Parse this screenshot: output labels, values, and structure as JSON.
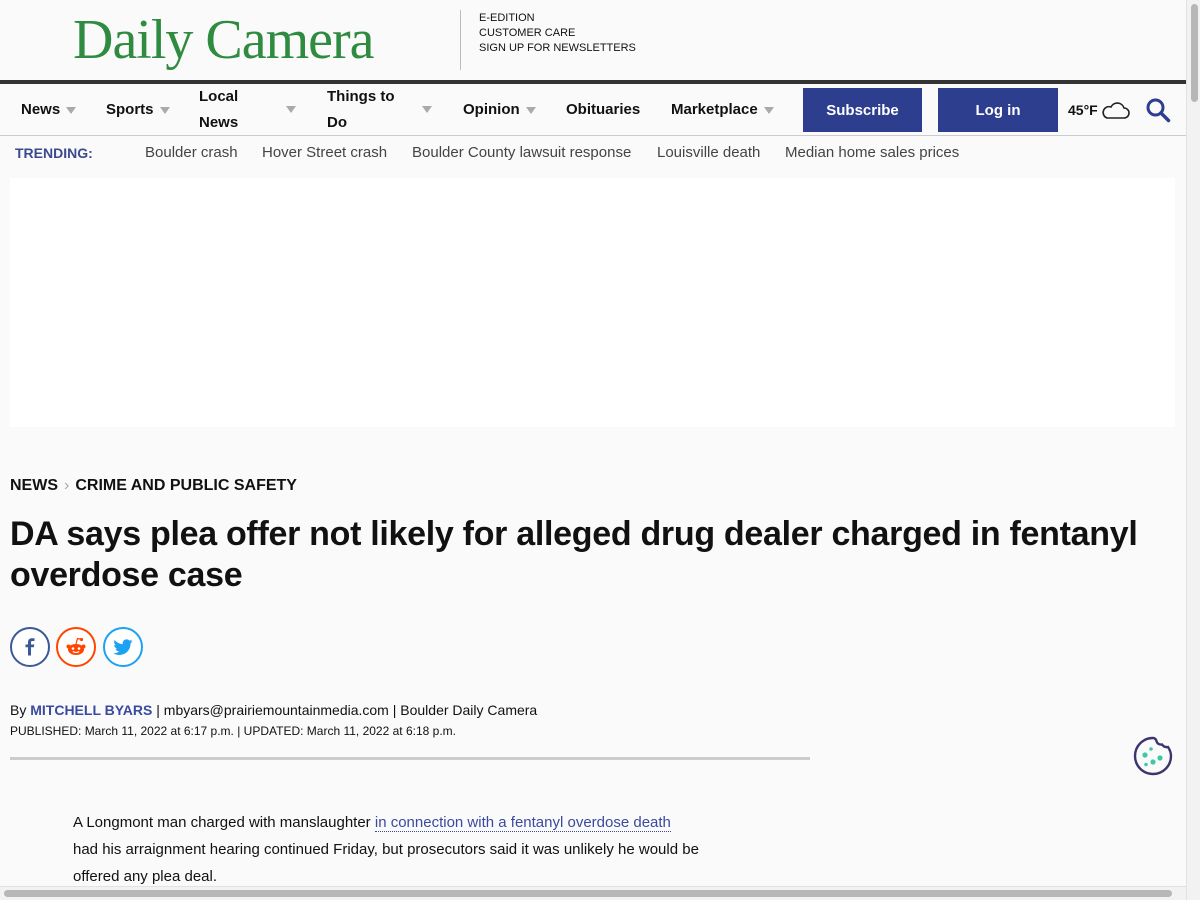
{
  "header": {
    "logo": "Daily Camera",
    "links": [
      "E-EDITION",
      "CUSTOMER CARE",
      "SIGN UP FOR NEWSLETTERS"
    ]
  },
  "nav": {
    "items": [
      {
        "label": "News",
        "dropdown": true
      },
      {
        "label": "Sports",
        "dropdown": true
      },
      {
        "label": "Local News",
        "dropdown": true
      },
      {
        "label": "Things to Do",
        "dropdown": true
      },
      {
        "label": "Opinion",
        "dropdown": true
      },
      {
        "label": "Obituaries",
        "dropdown": false
      },
      {
        "label": "Marketplace",
        "dropdown": true
      }
    ],
    "subscribe_label": "Subscribe",
    "login_label": "Log in",
    "weather": {
      "temp": "45°F",
      "icon": "cloud-icon"
    },
    "search_icon": "search-icon"
  },
  "trending": {
    "label": "TRENDING:",
    "links": [
      "Boulder crash",
      "Hover Street crash",
      "Boulder County lawsuit response",
      "Louisville death",
      "Median home sales prices"
    ]
  },
  "article": {
    "breadcrumb": [
      "NEWS",
      "CRIME AND PUBLIC SAFETY"
    ],
    "headline": "DA says plea offer not likely for alleged drug dealer charged in fentanyl overdose case",
    "share": [
      {
        "name": "facebook",
        "color": "#3b5998"
      },
      {
        "name": "reddit",
        "color": "#ff4500"
      },
      {
        "name": "twitter",
        "color": "#1da1f2"
      }
    ],
    "byline_prefix": "By",
    "author": "MITCHELL BYARS",
    "byline_rest": " | mbyars@prairiemountainmedia.com | Boulder Daily Camera",
    "dates": "PUBLISHED: March 11, 2022 at 6:17 p.m. | UPDATED: March 11, 2022 at 6:18 p.m.",
    "body_start": "A Longmont man charged with manslaughter ",
    "body_link": "in connection with a fentanyl overdose death",
    "body_line2": "had his arraignment hearing continued Friday, but prosecutors said it was unlikely he would be",
    "body_line3": "offered any plea deal."
  },
  "colors": {
    "brand_green": "#2f8b40",
    "brand_blue": "#2e3e8e"
  }
}
